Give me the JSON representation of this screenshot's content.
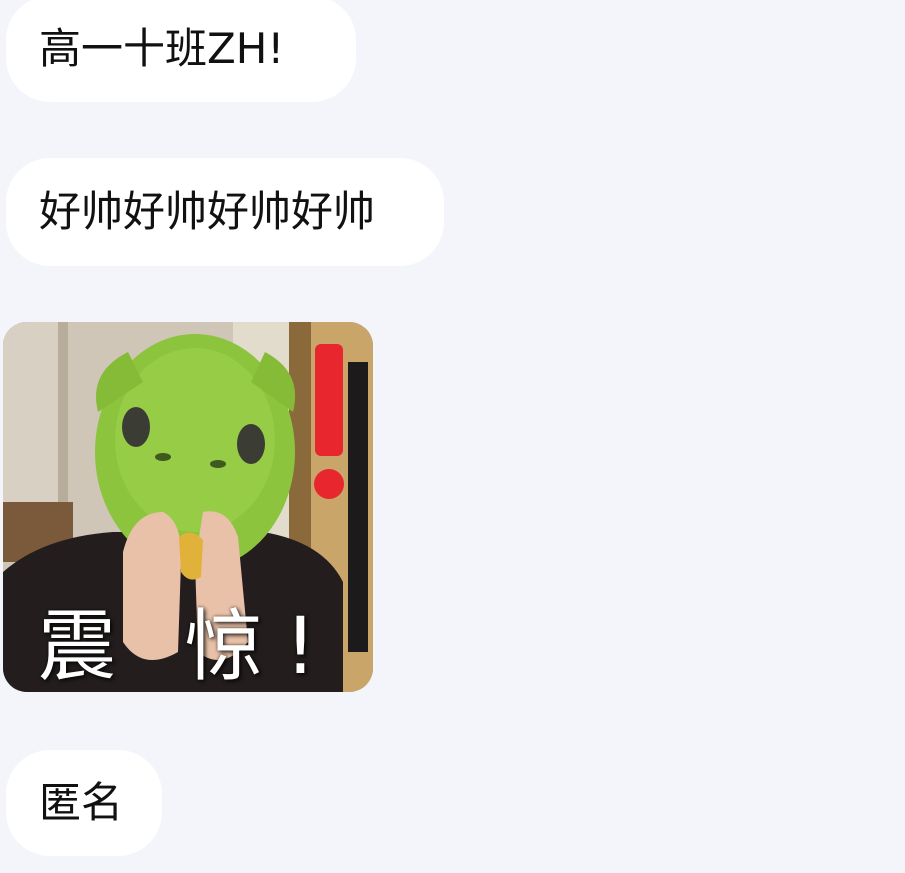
{
  "messages": [
    {
      "type": "text",
      "text": "高一十班ZH!"
    },
    {
      "type": "text",
      "text": "好帅好帅好帅好帅"
    },
    {
      "type": "sticker",
      "caption": "震 惊!",
      "icon": "shocked-green-mask-sticker"
    },
    {
      "type": "text",
      "text": "匿名"
    }
  ],
  "colors": {
    "background": "#f4f5fa",
    "bubble": "#ffffff",
    "text": "#111111",
    "mask_green": "#8dc43e",
    "exclamation_red": "#e8262e"
  }
}
